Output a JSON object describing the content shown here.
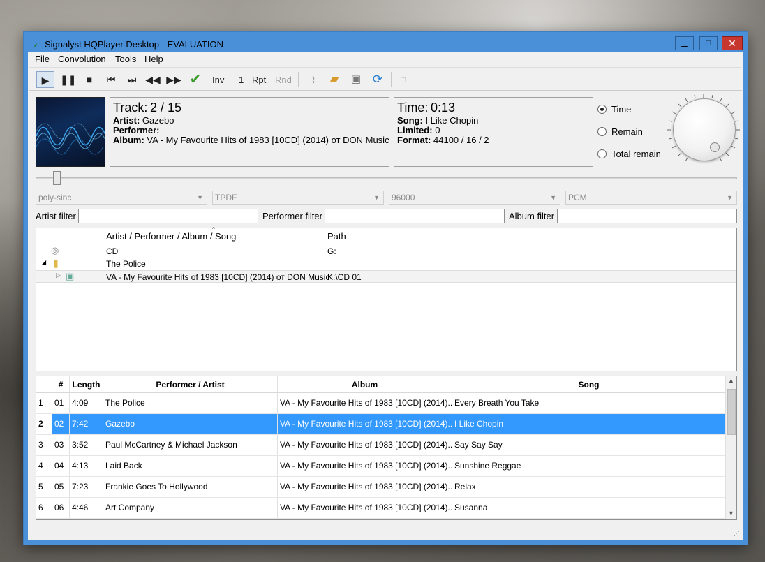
{
  "window": {
    "title": "Signalyst HQPlayer Desktop - EVALUATION",
    "close_symbol": "✕",
    "minimize_symbol": "▁",
    "maximize_symbol": "□"
  },
  "menu": [
    "File",
    "Convolution",
    "Tools",
    "Help"
  ],
  "toolbar": {
    "inv": "Inv",
    "count": "1",
    "rpt": "Rpt",
    "rnd": "Rnd"
  },
  "track_info": {
    "track_label": "Track:",
    "track_value": "2 / 15",
    "artist_label": "Artist:",
    "artist_value": "Gazebo",
    "performer_label": "Performer:",
    "performer_value": "",
    "album_label": "Album:",
    "album_value": "VA - My Favourite Hits of 1983 [10CD] (2014) от DON Music"
  },
  "time_info": {
    "time_label": "Time:",
    "time_value": "0:13",
    "song_label": "Song:",
    "song_value": "I Like Chopin",
    "limited_label": "Limited:",
    "limited_value": "0",
    "format_label": "Format:",
    "format_value": "44100 / 16 / 2"
  },
  "display_mode": {
    "options": [
      "Time",
      "Remain",
      "Total remain"
    ],
    "selected": "Time"
  },
  "progress": 0.03,
  "selects": {
    "filter": "poly-sinc",
    "dither": "TPDF",
    "rate": "96000",
    "mode": "PCM"
  },
  "filters": {
    "artist_label": "Artist filter",
    "artist_value": "",
    "performer_label": "Performer filter",
    "performer_value": "",
    "album_label": "Album filter",
    "album_value": ""
  },
  "library": {
    "columns": [
      "Artist / Performer / Album / Song",
      "Path"
    ],
    "rows": [
      {
        "name": "CD",
        "path": "G:"
      },
      {
        "name": "The Police",
        "path": ""
      },
      {
        "name": "VA - My Favourite Hits of 1983 [10CD] (2014) от DON Music",
        "path": "K:\\CD 01"
      }
    ]
  },
  "playlist": {
    "columns": [
      "#",
      "Length",
      "Performer / Artist",
      "Album",
      "Song"
    ],
    "rows": [
      {
        "idx": "1",
        "num": "01",
        "length": "4:09",
        "artist": "The Police",
        "album": "VA - My Favourite Hits of 1983 [10CD] (2014)...",
        "song": "Every Breath You Take"
      },
      {
        "idx": "2",
        "num": "02",
        "length": "7:42",
        "artist": "Gazebo",
        "album": "VA - My Favourite Hits of 1983 [10CD] (2014)...",
        "song": "I Like Chopin"
      },
      {
        "idx": "3",
        "num": "03",
        "length": "3:52",
        "artist": "Paul McCartney & Michael Jackson",
        "album": "VA - My Favourite Hits of 1983 [10CD] (2014)...",
        "song": "Say Say Say"
      },
      {
        "idx": "4",
        "num": "04",
        "length": "4:13",
        "artist": "Laid Back",
        "album": "VA - My Favourite Hits of 1983 [10CD] (2014)...",
        "song": "Sunshine Reggae"
      },
      {
        "idx": "5",
        "num": "05",
        "length": "7:23",
        "artist": "Frankie Goes To Hollywood",
        "album": "VA - My Favourite Hits of 1983 [10CD] (2014)...",
        "song": "Relax"
      },
      {
        "idx": "6",
        "num": "06",
        "length": "4:46",
        "artist": "Art Company",
        "album": "VA - My Favourite Hits of 1983 [10CD] (2014)...",
        "song": "Susanna"
      }
    ],
    "selected_index": 1
  },
  "colors": {
    "selection": "#3399ff",
    "title_bar": "#4a90d9",
    "close_button": "#c7372f"
  }
}
